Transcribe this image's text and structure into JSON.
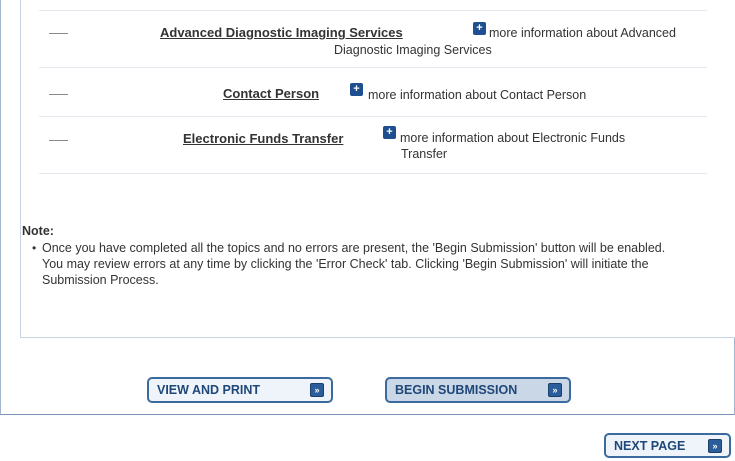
{
  "topics": [
    {
      "label": "Advanced Diagnostic Imaging Services",
      "info_line1": "more information about  Advanced",
      "info_line2": "Diagnostic Imaging Services"
    },
    {
      "label": "Contact Person",
      "info_line1": "more information about  Contact Person",
      "info_line2": ""
    },
    {
      "label": "Electronic Funds Transfer",
      "info_line1": "more information about  Electronic Funds",
      "info_line2": "Transfer"
    }
  ],
  "plus_icon": "+",
  "note": {
    "title": "Note:",
    "bullet": "•",
    "text": "Once you have completed all the topics and no errors are present, the 'Begin Submission' button will be enabled. You may review errors at any time by clicking the 'Error Check' tab. Clicking 'Begin Submission' will initiate the Submission Process."
  },
  "buttons": {
    "view_print": "VIEW AND PRINT",
    "begin_submission": "BEGIN SUBMISSION",
    "next_page": "NEXT PAGE",
    "arrow_glyph": "»"
  },
  "colors": {
    "accent": "#1d4f91",
    "button_border": "#3b6a9e",
    "button_text": "#1f4778"
  }
}
